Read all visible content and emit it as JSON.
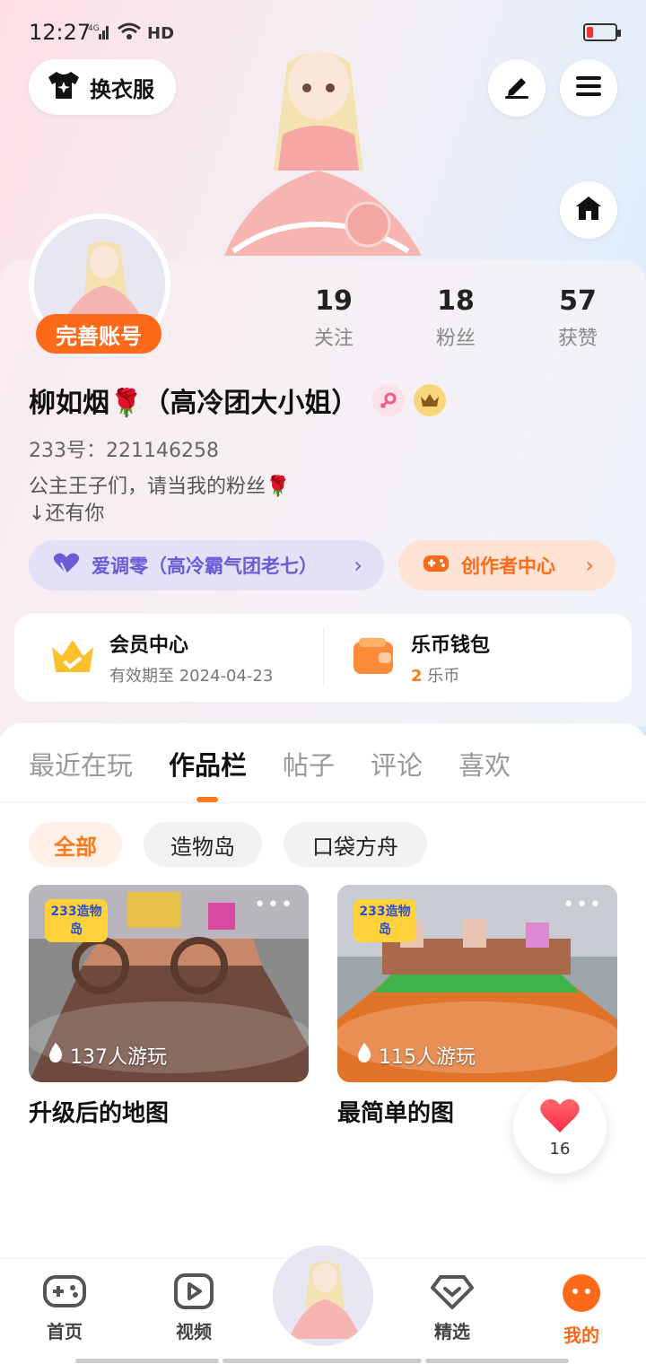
{
  "status_bar": {
    "time": "12:27",
    "network": "4G",
    "hd": "HD"
  },
  "header": {
    "outfit_button": "换衣服"
  },
  "profile": {
    "complete_badge": "完善账号",
    "stats": [
      {
        "value": "19",
        "label": "关注"
      },
      {
        "value": "18",
        "label": "粉丝"
      },
      {
        "value": "57",
        "label": "获赞"
      }
    ],
    "name": "柳如烟🌹（高冷团大小姐）",
    "id_line": "233号：221146258",
    "bio_line1": "公主王子们，请当我的粉丝🌹",
    "bio_line2": "↓还有你"
  },
  "pills": {
    "group": "爱调零（高冷霸气团老七）",
    "creator": "创作者中心"
  },
  "vip": {
    "member_title": "会员中心",
    "member_sub": "有效期至 2024-04-23",
    "wallet_title": "乐币钱包",
    "wallet_amount": "2",
    "wallet_unit": "乐币"
  },
  "tabs": [
    "最近在玩",
    "作品栏",
    "帖子",
    "评论",
    "喜欢"
  ],
  "active_tab": "作品栏",
  "chips": [
    "全部",
    "造物岛",
    "口袋方舟"
  ],
  "cards": [
    {
      "badge": "233造物岛",
      "plays": "137人游玩",
      "title": "升级后的地图"
    },
    {
      "badge": "233造物岛",
      "plays": "115人游玩",
      "title": "最简单的图"
    }
  ],
  "like_count": "16",
  "nav": {
    "home": "首页",
    "video": "视频",
    "featured": "精选",
    "mine": "我的"
  },
  "colors": {
    "accent": "#ff6a1a",
    "purple": "#6b5bd6",
    "pill_purple_bg": "#e3e1f7",
    "pill_orange_bg": "#fde3d3"
  }
}
